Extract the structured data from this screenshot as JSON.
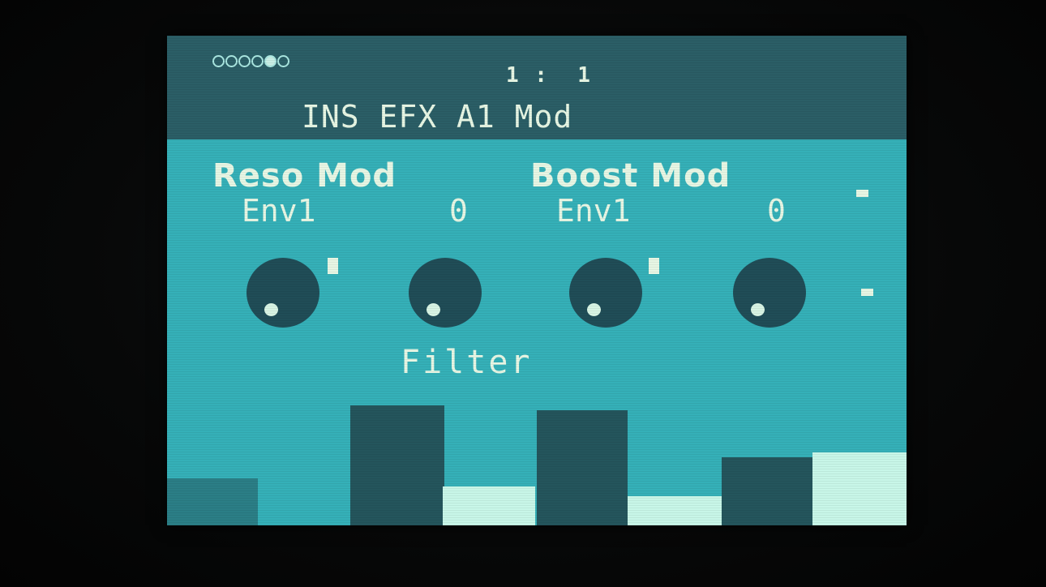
{
  "header": {
    "page_dots": 6,
    "active_dot": 4,
    "position_readout": "1 :  1",
    "title": "INS EFX A1 Mod"
  },
  "params": [
    {
      "label": "Reso Mod",
      "source": "Env1",
      "amount": "0"
    },
    {
      "label": "Boost Mod",
      "source": "Env1",
      "amount": "0"
    }
  ],
  "section_label": "Filter",
  "knobs": [
    {
      "name": "knob-1"
    },
    {
      "name": "knob-2"
    },
    {
      "name": "knob-3"
    },
    {
      "name": "knob-4"
    }
  ],
  "colors": {
    "screen_bg": "#35b0b8",
    "header_bg": "#2b5e66",
    "text": "#e7f6e4",
    "knob": "#204d57",
    "bar_dark": "#24555c",
    "bar_light": "#c8f6e8"
  }
}
